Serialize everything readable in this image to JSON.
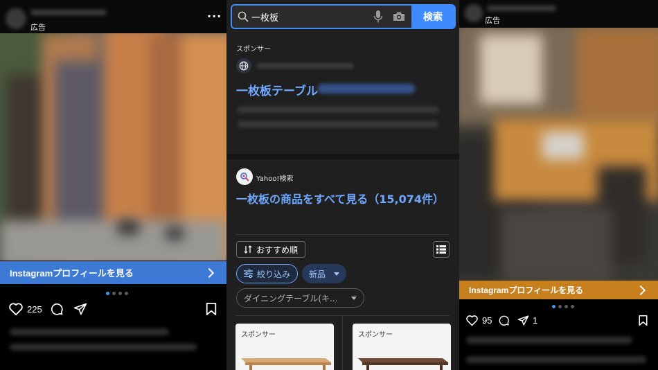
{
  "left_post": {
    "ad_label": "広告",
    "cta_label": "Instagramプロフィールを見る",
    "like_count": "225",
    "cta_color": "#3d7ad6"
  },
  "search": {
    "query": "一枚板",
    "button_label": "検索",
    "accent": "#3d8bfd"
  },
  "sponsored_ad": {
    "label": "スポンサー",
    "title": "一枚板テーブル"
  },
  "yahoo": {
    "label": "Yahoo!検索",
    "all_items_link": "一枚板の商品をすべて見る（15,074件）"
  },
  "filters": {
    "sort_label": "おすすめ順",
    "filter_label": "絞り込み",
    "new_label": "新品",
    "category_label": "ダイニングテーブル(キ..."
  },
  "products": [
    {
      "label": "スポンサー"
    },
    {
      "label": "スポンサー"
    }
  ],
  "right_post": {
    "ad_label": "広告",
    "cta_label": "Instagramプロフィールを見る",
    "like_count": "95",
    "share_count": "1",
    "cta_color": "#c8801f"
  },
  "icons": [
    "search-icon",
    "mic-icon",
    "camera-icon",
    "globe-icon",
    "sort-icon",
    "list-view-icon",
    "filter-icon",
    "heart-icon",
    "comment-icon",
    "share-icon",
    "bookmark-icon",
    "more-icon",
    "chevron-right-icon"
  ]
}
